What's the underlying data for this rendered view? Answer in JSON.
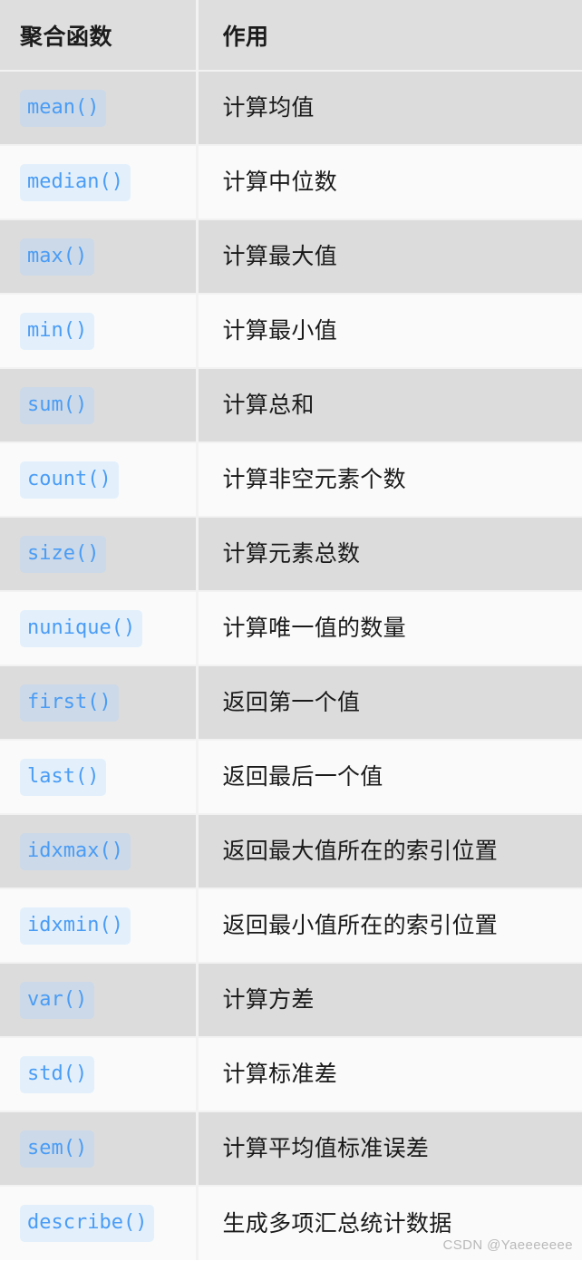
{
  "table": {
    "headers": {
      "function": "聚合函数",
      "description": "作用"
    },
    "rows": [
      {
        "function": "mean()",
        "description": "计算均值"
      },
      {
        "function": "median()",
        "description": "计算中位数"
      },
      {
        "function": "max()",
        "description": "计算最大值"
      },
      {
        "function": "min()",
        "description": "计算最小值"
      },
      {
        "function": "sum()",
        "description": "计算总和"
      },
      {
        "function": "count()",
        "description": "计算非空元素个数"
      },
      {
        "function": "size()",
        "description": "计算元素总数"
      },
      {
        "function": "nunique()",
        "description": "计算唯一值的数量"
      },
      {
        "function": "first()",
        "description": "返回第一个值"
      },
      {
        "function": "last()",
        "description": "返回最后一个值"
      },
      {
        "function": "idxmax()",
        "description": "返回最大值所在的索引位置"
      },
      {
        "function": "idxmin()",
        "description": "返回最小值所在的索引位置"
      },
      {
        "function": "var()",
        "description": "计算方差"
      },
      {
        "function": "std()",
        "description": "计算标准差"
      },
      {
        "function": "sem()",
        "description": "计算平均值标准误差"
      },
      {
        "function": "describe()",
        "description": "生成多项汇总统计数据"
      }
    ]
  },
  "watermark": {
    "text": "CSDN @Yaeeeeeee"
  },
  "colors": {
    "header_background": "#dedede",
    "row_shaded_background": "#dcdcdc",
    "row_plain_background": "#fafafa",
    "grid_line": "#f2f2f2",
    "code_text": "#4a9cf5",
    "code_chip_on_shaded": "#ccd9e8",
    "code_chip_on_plain": "#e3f0fb",
    "body_text": "#1a1a1a",
    "watermark_text": "#b9b9b9"
  }
}
